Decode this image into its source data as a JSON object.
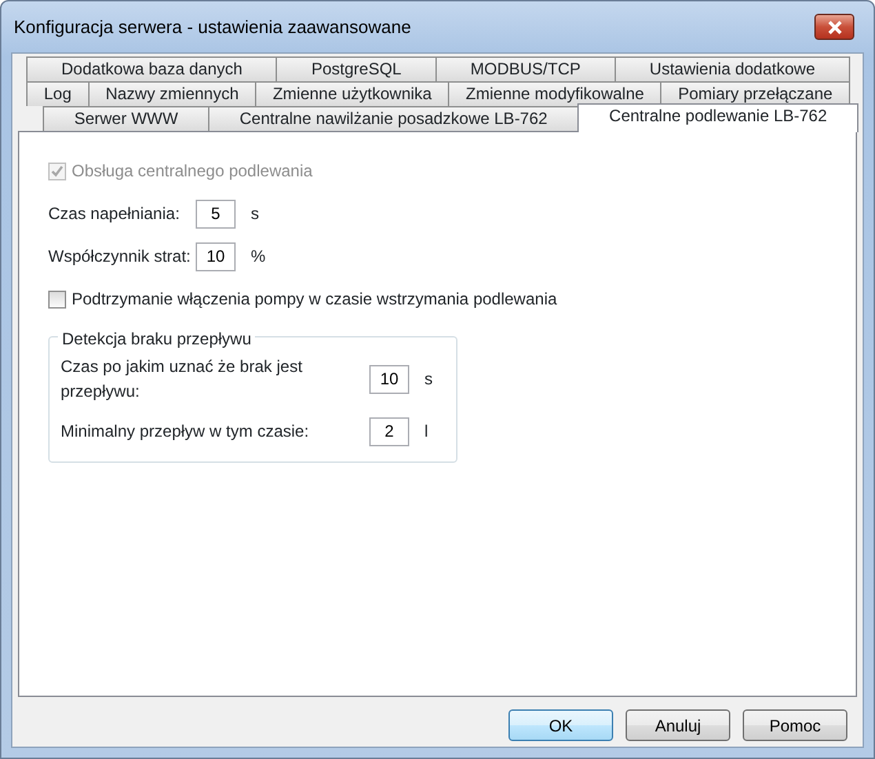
{
  "window": {
    "title": "Konfiguracja serwera - ustawienia zaawansowane"
  },
  "tab_rows": [
    [
      {
        "label": "Dodatkowa baza danych",
        "selected": false
      },
      {
        "label": "PostgreSQL",
        "selected": false
      },
      {
        "label": "MODBUS/TCP",
        "selected": false
      },
      {
        "label": "Ustawienia dodatkowe",
        "selected": false
      }
    ],
    [
      {
        "label": "Log",
        "selected": false
      },
      {
        "label": "Nazwy zmiennych",
        "selected": false
      },
      {
        "label": "Zmienne użytkownika",
        "selected": false
      },
      {
        "label": "Zmienne modyfikowalne",
        "selected": false
      },
      {
        "label": "Pomiary przełączane",
        "selected": false
      }
    ],
    [
      {
        "label": "Serwer WWW",
        "selected": false
      },
      {
        "label": "Centralne nawilżanie posadzkowe LB-762",
        "selected": false
      },
      {
        "label": "Centralne podlewanie LB-762",
        "selected": true
      }
    ]
  ],
  "fields": [
    {
      "kind": "checkbox",
      "label": "Obsługa centralnego podlewania",
      "checked": true,
      "disabled": true
    },
    {
      "kind": "number",
      "label": "Czas napełniania:",
      "value": "5",
      "unit": "s"
    },
    {
      "kind": "number",
      "label": "Współczynnik strat:",
      "value": "10",
      "unit": "%"
    },
    {
      "kind": "checkbox",
      "label": "Podtrzymanie włączenia pompy w czasie wstrzymania podlewania",
      "checked": false,
      "disabled": false
    }
  ],
  "group": {
    "title": "Detekcja braku przepływu",
    "fields": [
      {
        "kind": "number",
        "label": "Czas po jakim uznać że brak jest przepływu:",
        "value": "10",
        "unit": "s"
      },
      {
        "kind": "number",
        "label": "Minimalny przepływ w tym czasie:",
        "value": "2",
        "unit": "l"
      }
    ]
  },
  "buttons": [
    {
      "label": "OK",
      "default": true
    },
    {
      "label": "Anuluj",
      "default": false
    },
    {
      "label": "Pomoc",
      "default": false
    }
  ]
}
